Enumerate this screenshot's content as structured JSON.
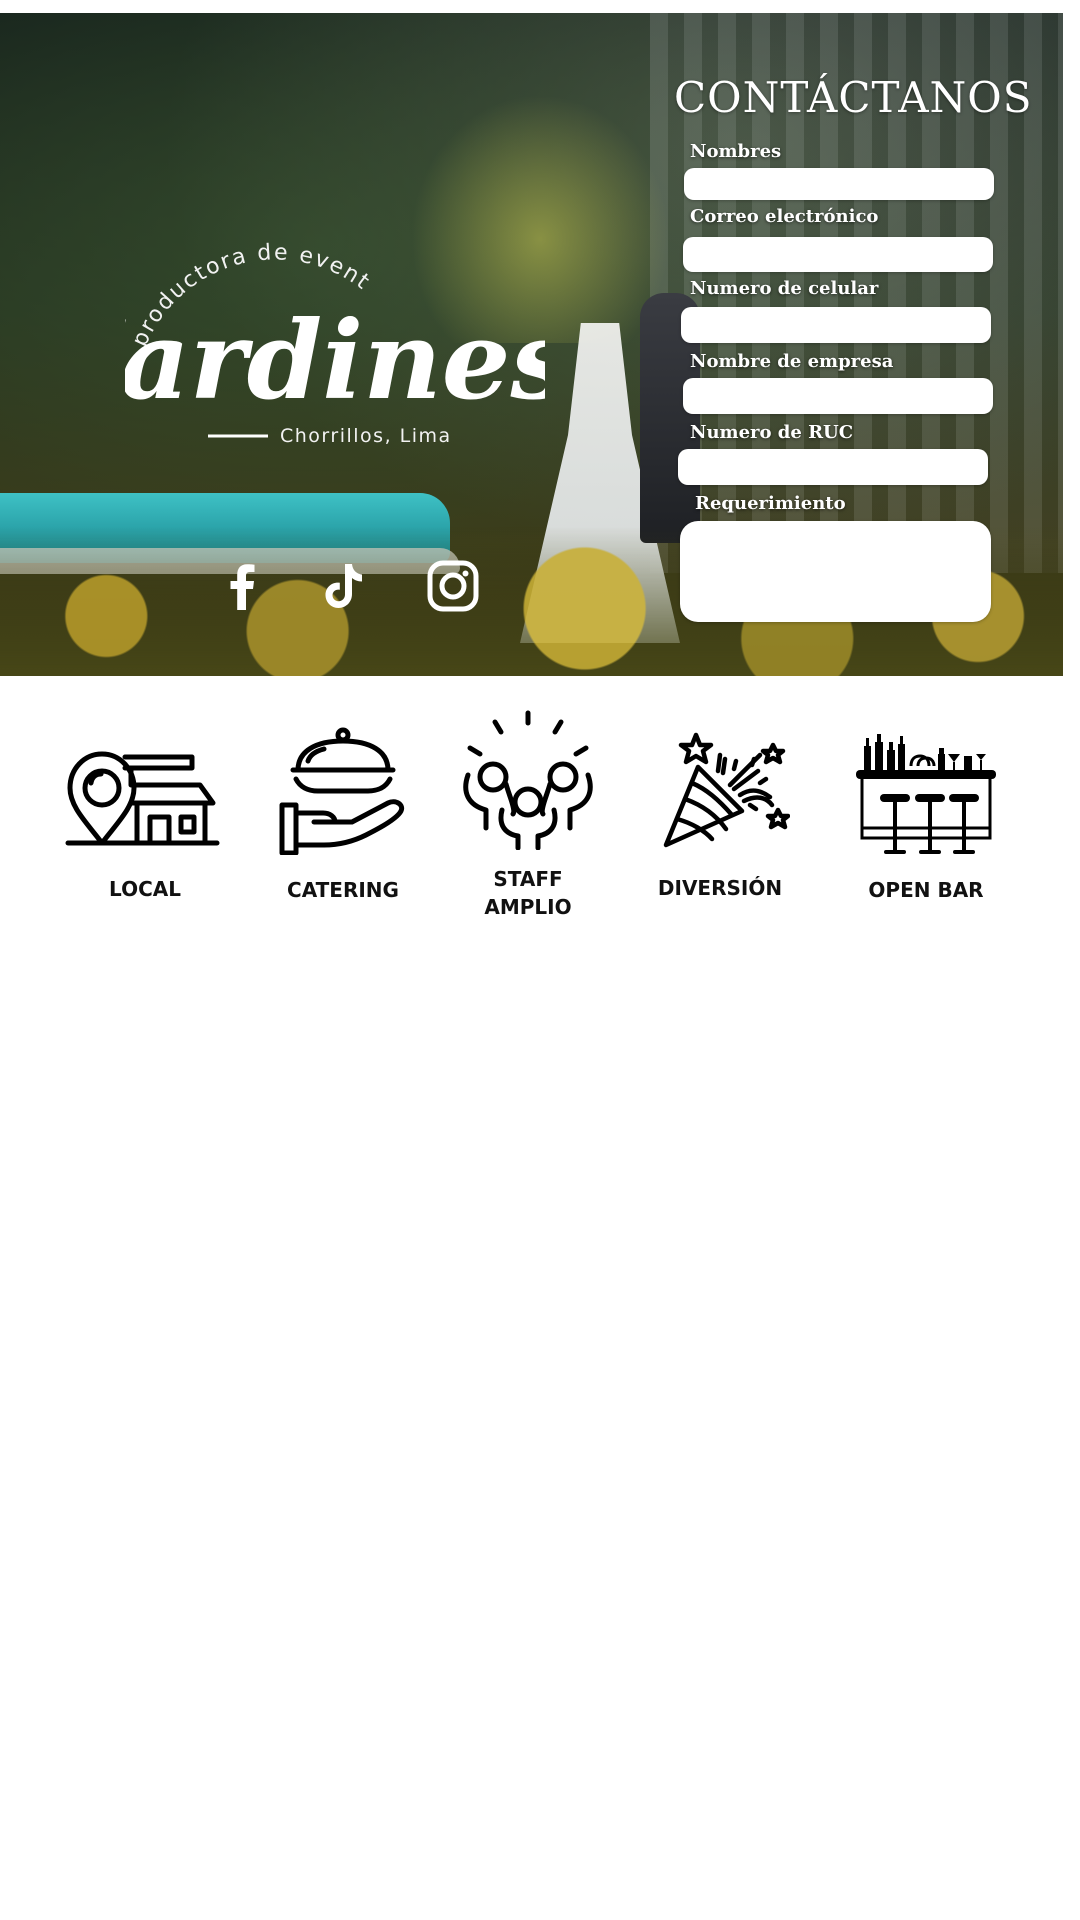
{
  "hero": {
    "logo": {
      "tagline": "productora de eventos",
      "name": "Jardines",
      "location": "Chorrillos, Lima"
    },
    "socials": [
      {
        "icon": "facebook-icon"
      },
      {
        "icon": "tiktok-icon"
      },
      {
        "icon": "instagram-icon"
      }
    ]
  },
  "contact": {
    "title": "CONTÁCTANOS",
    "fields": {
      "nombres": {
        "label": "Nombres",
        "value": ""
      },
      "correo": {
        "label": "Correo electrónico",
        "value": ""
      },
      "celular": {
        "label": "Numero de celular",
        "value": ""
      },
      "empresa": {
        "label": "Nombre de empresa",
        "value": ""
      },
      "ruc": {
        "label": "Numero de RUC",
        "value": ""
      },
      "requerimiento": {
        "label": "Requerimiento",
        "value": ""
      }
    }
  },
  "services": [
    {
      "icon": "location-house-icon",
      "label": "LOCAL"
    },
    {
      "icon": "catering-cloche-icon",
      "label": "CATERING"
    },
    {
      "icon": "staff-group-icon",
      "label_line1": "STAFF",
      "label_line2": "AMPLIO"
    },
    {
      "icon": "party-popper-icon",
      "label": "DIVERSIÓN"
    },
    {
      "icon": "open-bar-icon",
      "label": "OPEN BAR"
    }
  ]
}
